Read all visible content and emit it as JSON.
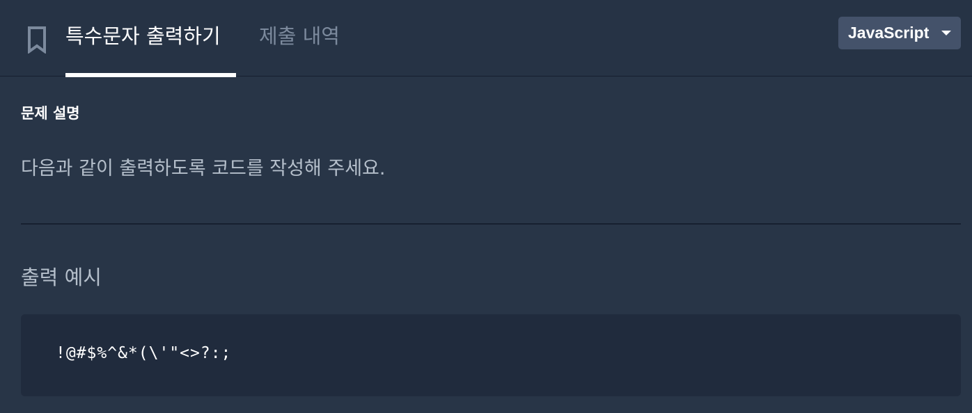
{
  "header": {
    "tabs": [
      {
        "label": "특수문자 출력하기",
        "active": true
      },
      {
        "label": "제출 내역",
        "active": false
      }
    ],
    "language_select": {
      "selected": "JavaScript"
    }
  },
  "problem": {
    "section_title": "문제 설명",
    "description": "다음과 같이 출력하도록 코드를 작성해 주세요.",
    "example_title": "출력 예시",
    "example_output": "!@#$%^&*(\\'\"<>?:;"
  },
  "colors": {
    "background": "#263345",
    "code_background": "#202b3d",
    "select_background": "#44526a",
    "inactive_tab": "#7c8a9d",
    "muted_text": "#b5bfcb"
  },
  "icons": {
    "bookmark": "bookmark-icon",
    "dropdown": "caret-down-icon"
  }
}
